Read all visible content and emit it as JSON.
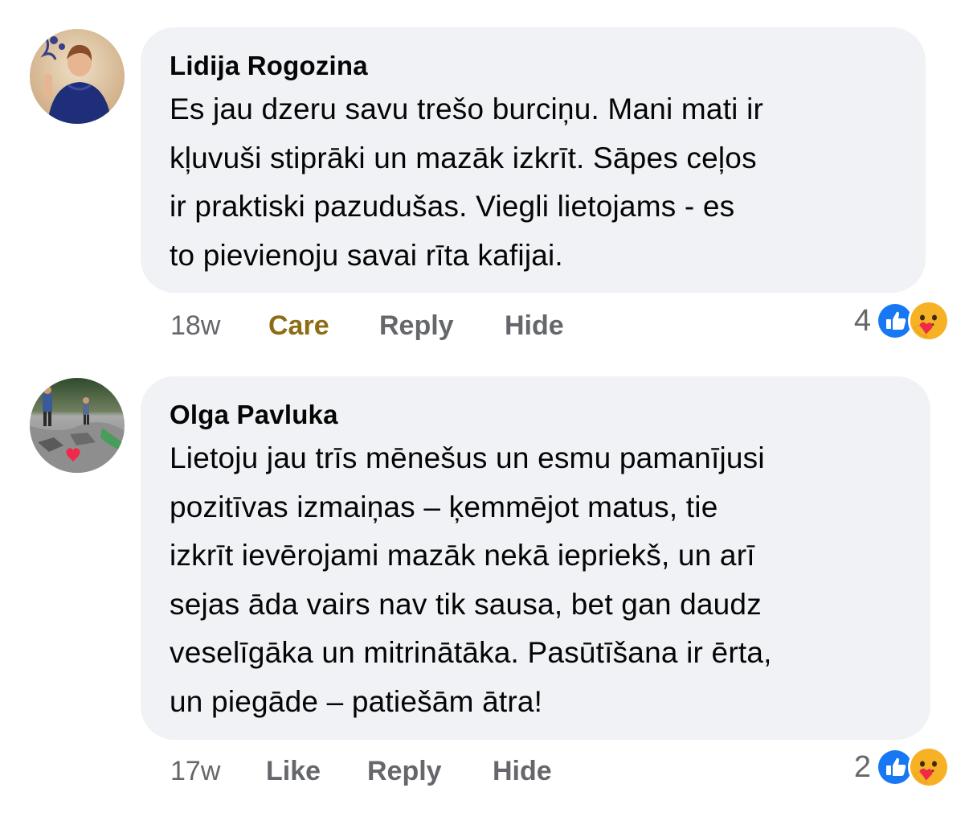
{
  "comments": [
    {
      "author": "Lidija Rogozina",
      "text": "Es jau dzeru savu trešo burciņu. Mani mati ir\nkļuvuši stiprāki un mazāk izkrīt. Sāpes ceļos\nir praktiski pazudušas. Viegli lietojams - es\nto pievienoju savai rīta kafijai.",
      "time": "18w",
      "reaction_action": "Care",
      "reaction_action_color": "#8c6d14",
      "reply_label": "Reply",
      "hide_label": "Hide",
      "reaction_count": "4",
      "reaction_icons": [
        "like-icon",
        "care-icon"
      ]
    },
    {
      "author": "Olga Pavluka",
      "text": "Lietoju jau trīs mēnešus un esmu pamanījusi\npozitīvas izmaiņas – ķemmējot matus, tie\nizkrīt ievērojami mazāk nekā iepriekš, un arī\nsejas āda vairs nav tik sausa, bet gan daudz\nveselīgāka un mitrinātāka. Pasūtīšana ir ērta,\nun piegāde – patiešām ātra!",
      "time": "17w",
      "reaction_action": "Like",
      "reply_label": "Reply",
      "hide_label": "Hide",
      "reaction_count": "2",
      "reaction_icons": [
        "like-icon",
        "care-icon"
      ]
    }
  ],
  "colors": {
    "bubble_bg": "#f0f2f5",
    "meta_text": "#65676b",
    "like_blue": "#1877f2",
    "care_yellow": "#f7b125"
  }
}
